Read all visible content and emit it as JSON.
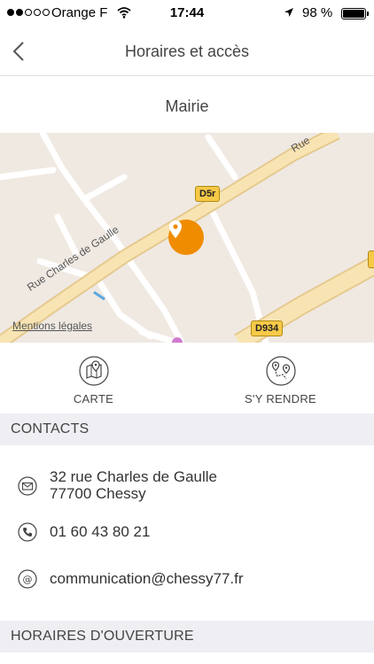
{
  "status_bar": {
    "carrier": "Orange F",
    "time": "17:44",
    "battery": "98 %",
    "battery_level": 0.98
  },
  "nav": {
    "title": "Horaires et accès",
    "back_icon": "chevron-left-icon"
  },
  "place": {
    "name": "Mairie"
  },
  "map": {
    "legal_link": "Mentions légales",
    "street_label": "Rue Charles de Gaulle",
    "street_label_top": "Rue",
    "road_d5r": "D5r",
    "road_d934": "D934",
    "marker_color": "#f08c00"
  },
  "actions": [
    {
      "label": "CARTE",
      "icon": "map-icon"
    },
    {
      "label": "S'Y RENDRE",
      "icon": "directions-icon"
    }
  ],
  "contacts": {
    "header": "CONTACTS",
    "address_line1": "32 rue Charles de Gaulle",
    "address_line2": "77700 Chessy",
    "phone": "01 60 43 80 21",
    "email": "communication@chessy77.fr"
  },
  "hours": {
    "header": "HORAIRES D'OUVERTURE"
  }
}
